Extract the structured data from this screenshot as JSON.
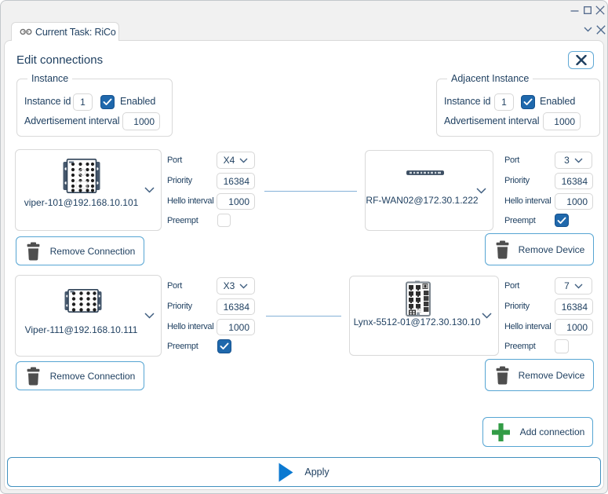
{
  "window": {
    "controls": {
      "minimize": "minimize",
      "maximize": "maximize",
      "close": "close"
    }
  },
  "tab": {
    "icon": "link-chain-icon",
    "label": "Current Task: RiCo",
    "strip_icons": {
      "collapse": "chevron-down",
      "close": "close-x"
    }
  },
  "dialog": {
    "title": "Edit connections",
    "close_icon": "close-x"
  },
  "field_labels": {
    "instance_id": "Instance id",
    "enabled": "Enabled",
    "advertisement_interval": "Advertisement interval",
    "port": "Port",
    "priority": "Priority",
    "hello_interval": "Hello interval",
    "preempt": "Preempt"
  },
  "instance_group": {
    "legend": "Instance",
    "instance_id_value": "1",
    "enabled_checked": true,
    "advertisement_interval_value": "1000"
  },
  "adjacent_group": {
    "legend": "Adjacent Instance",
    "instance_id_value": "1",
    "enabled_checked": true,
    "advertisement_interval_value": "1000"
  },
  "connections": [
    {
      "left": {
        "device": "viper-101@192.168.10.101",
        "device_image": "viper-101-switch",
        "port": "X4",
        "priority": "16384",
        "hello_interval": "1000",
        "preempt": false
      },
      "right": {
        "device": "RF-WAN02@172.30.1.222",
        "device_image": "rf-wan02-router",
        "port": "3",
        "priority": "16384",
        "hello_interval": "1000",
        "preempt": true
      }
    },
    {
      "left": {
        "device": "Viper-111@192.168.10.111",
        "device_image": "viper-111-switch",
        "port": "X3",
        "priority": "16384",
        "hello_interval": "1000",
        "preempt": true
      },
      "right": {
        "device": "Lynx-5512-01@172.30.130.10",
        "device_image": "lynx-5512-switch",
        "port": "7",
        "priority": "16384",
        "hello_interval": "1000",
        "preempt": false
      }
    }
  ],
  "buttons": {
    "remove_connection": "Remove Connection",
    "remove_device": "Remove Device",
    "add_connection": "Add connection",
    "apply": "Apply"
  },
  "colors": {
    "navy_text": "#1d3e5f",
    "checkbox_blue": "#1f68ac",
    "button_border_blue": "#56a5d3",
    "connector_line_blue": "#84b1d8",
    "add_green": "#339c46",
    "apply_play_blue": "#0b79d1"
  }
}
